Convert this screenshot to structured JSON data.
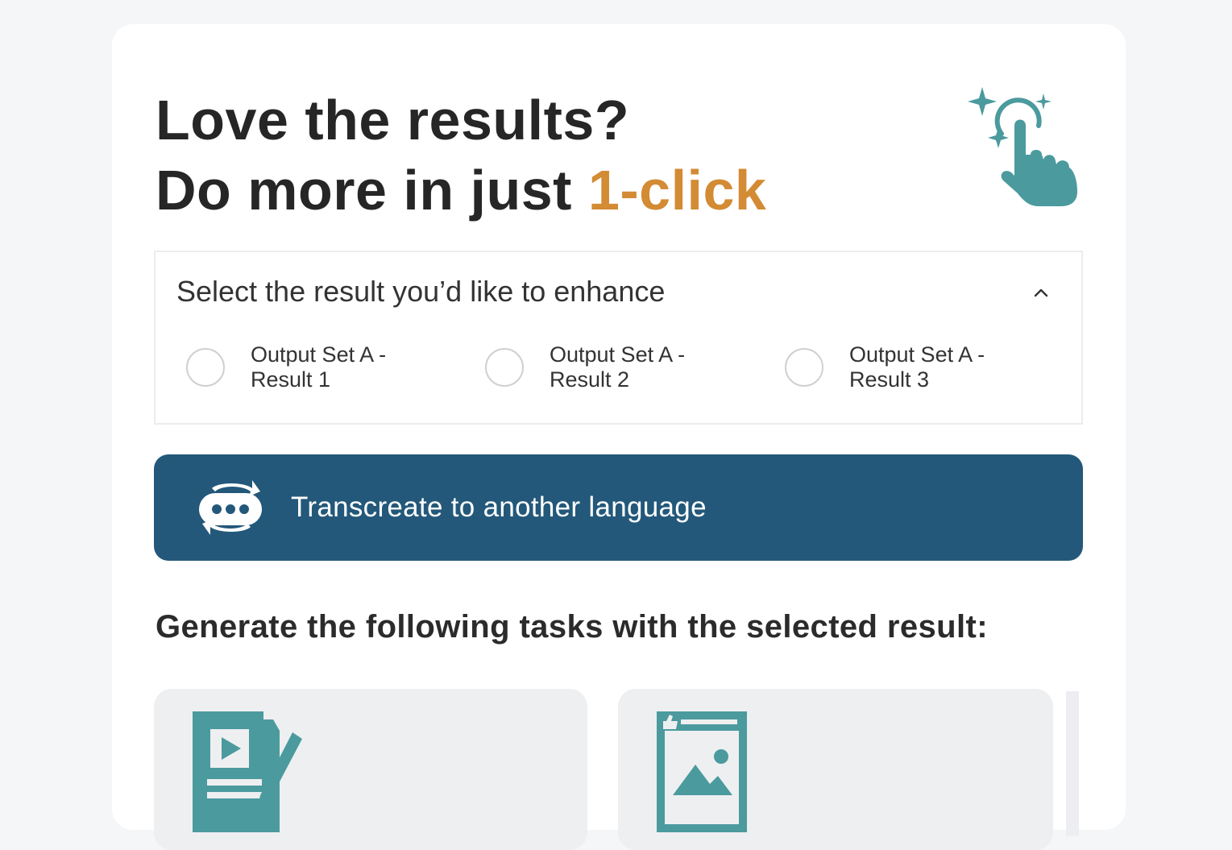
{
  "headline": {
    "line1": "Love the results?",
    "line2_prefix": "Do more in just ",
    "line2_accent": "1-click"
  },
  "select": {
    "title": "Select the result you’d like to enhance",
    "options": [
      {
        "label": "Output Set A - Result 1",
        "selected": false
      },
      {
        "label": "Output Set A - Result 2",
        "selected": false
      },
      {
        "label": "Output Set A - Result 3",
        "selected": false
      }
    ]
  },
  "cta": {
    "label": "Transcreate to another language"
  },
  "tasks": {
    "heading": "Generate the following tasks with the selected result:",
    "cards": [
      {
        "icon": "video-script-icon"
      },
      {
        "icon": "social-post-image-icon"
      }
    ]
  },
  "colors": {
    "accent": "#d38b34",
    "teal": "#4b9a9e",
    "cta_bg": "#23587a",
    "card_bg": "#eeeff1"
  }
}
